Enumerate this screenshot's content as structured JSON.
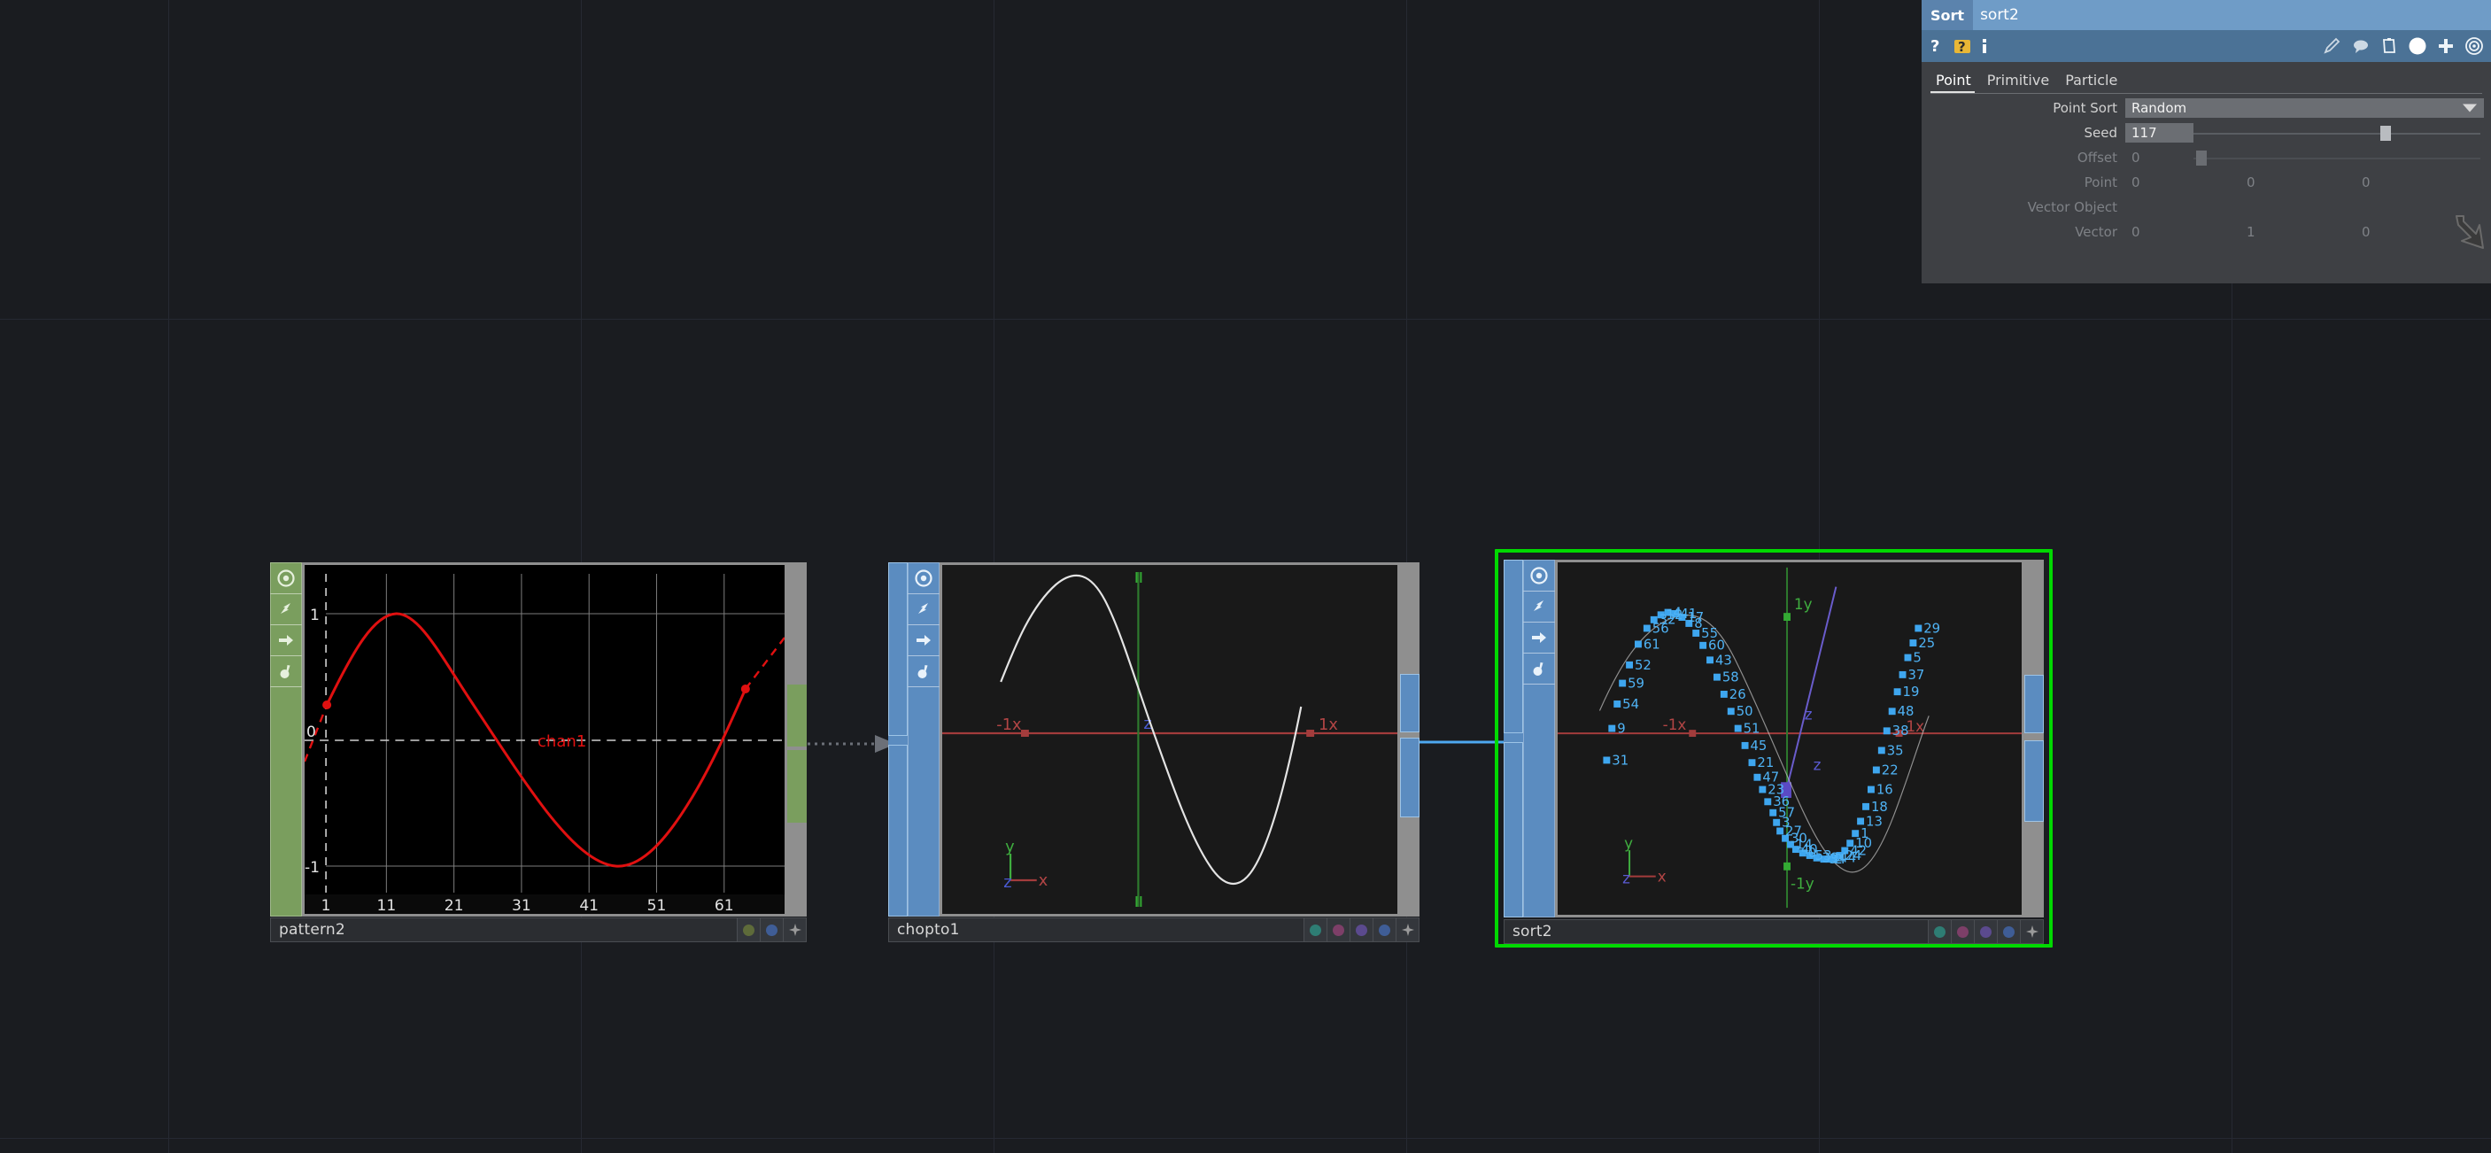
{
  "app": {
    "background": "#1a1c20",
    "grid_color": "#262932"
  },
  "parameter_panel": {
    "type_label": "Sort",
    "node_name": "sort2",
    "toolbar_left_icons": [
      "help-question-icon",
      "help-question-yellow-icon",
      "info-icon"
    ],
    "toolbar_right_icons": [
      "pencil-icon",
      "comment-icon",
      "clipboard-icon",
      "python-icon",
      "plus-icon",
      "target-icon"
    ],
    "tabs": [
      {
        "label": "Point",
        "active": true
      },
      {
        "label": "Primitive",
        "active": false
      },
      {
        "label": "Particle",
        "active": false
      }
    ],
    "rows": [
      {
        "label": "Point Sort",
        "type": "menu",
        "value": "Random",
        "enabled": true
      },
      {
        "label": "Seed",
        "type": "field_slider",
        "value": "117",
        "enabled": true,
        "slider_pct": 65
      },
      {
        "label": "Offset",
        "type": "field_slider",
        "value": "0",
        "enabled": false,
        "slider_pct": 2
      },
      {
        "label": "Point",
        "type": "vector3",
        "values": [
          "0",
          "0",
          "0"
        ],
        "enabled": false
      },
      {
        "label": "Vector Object",
        "type": "label_only",
        "value": "",
        "enabled": false
      },
      {
        "label": "Vector",
        "type": "vector3",
        "values": [
          "0",
          "1",
          "0"
        ],
        "enabled": false
      }
    ],
    "colors": {
      "title_bar": "#5b83ad",
      "tool_bar": "#4b7296",
      "body": "#3e4044",
      "field": "#6b6e73"
    }
  },
  "network": {
    "nodes": [
      {
        "name": "pattern2",
        "type": "channel-pattern",
        "selected": false,
        "accent": "#7a9e5e",
        "flags": [
          "display-render-icon",
          "channel-motion-icon",
          "bypass-arrow-icon",
          "lock-icon"
        ],
        "badges": [
          "olive-dot",
          "blue-dot",
          "plus-icon"
        ],
        "badge_colors": [
          "#5e6b3a",
          "#3f5d96",
          "#9a9a9a"
        ],
        "viewer_kind": "channel_graph"
      },
      {
        "name": "chopto1",
        "type": "chop-to-geometry",
        "selected": false,
        "accent": "#5b8cc0",
        "flags": [
          "display-render-icon",
          "channel-motion-icon",
          "bypass-arrow-icon",
          "lock-icon"
        ],
        "badges": [
          "teal-dot",
          "magenta-dot",
          "violet-dot",
          "blue-dot",
          "plus-icon"
        ],
        "badge_colors": [
          "#2e7d74",
          "#7d3f68",
          "#5b4a8e",
          "#3f5d96",
          "#9a9a9a"
        ],
        "viewer_kind": "geometry_curve"
      },
      {
        "name": "sort2",
        "type": "sort",
        "selected": true,
        "accent": "#5b8cc0",
        "flags": [
          "display-render-icon",
          "channel-motion-icon",
          "bypass-arrow-icon",
          "lock-icon"
        ],
        "badges": [
          "teal-dot",
          "magenta-dot",
          "violet-dot",
          "blue-dot",
          "plus-icon"
        ],
        "badge_colors": [
          "#2e7d74",
          "#7d3f68",
          "#5b4a8e",
          "#3f5d96",
          "#9a9a9a"
        ],
        "viewer_kind": "geometry_points"
      }
    ],
    "connections": [
      {
        "from": "pattern2",
        "to": "chopto1",
        "style": "dotted",
        "color": "#6c7078"
      },
      {
        "from": "chopto1",
        "to": "sort2",
        "style": "solid",
        "color": "#4ea8f0"
      }
    ],
    "selection_color": "#00d900"
  },
  "chart_data": [
    {
      "node": "pattern2",
      "type": "line",
      "title": "",
      "series_label": "chan1",
      "series_color": "#e01010",
      "xlabel": "",
      "ylabel": "",
      "xticks": [
        "1",
        "11",
        "21",
        "31",
        "41",
        "51",
        "61"
      ],
      "yticks": [
        "1",
        "0",
        "-1"
      ],
      "xlim": [
        -4,
        64
      ],
      "ylim": [
        -1.45,
        1.35
      ],
      "grid": true,
      "x": [
        1,
        6,
        11,
        13,
        16,
        21,
        26,
        31,
        36,
        41,
        43,
        46,
        51,
        56,
        61
      ],
      "values": [
        0.3,
        0.85,
        1.0,
        1.0,
        0.92,
        0.55,
        0.05,
        -0.5,
        -0.88,
        -1.0,
        -1.0,
        -0.86,
        -0.44,
        0.12,
        0.62
      ],
      "keyframes": [
        {
          "x": 1,
          "y": 0.3
        },
        {
          "x": 58,
          "y": 0.42
        }
      ],
      "extrapolation": "dashed-linear"
    },
    {
      "node": "chopto1",
      "type": "line",
      "title": "",
      "series_color": "#e8e8e8",
      "axis_labels": {
        "x_neg": "-1x",
        "x_pos": "1x",
        "z": "z"
      },
      "gnomon": [
        "y",
        "z",
        "x"
      ],
      "grid": false,
      "x": [
        0.0,
        0.05,
        0.1,
        0.15,
        0.2,
        0.25,
        0.3,
        0.35,
        0.4,
        0.45,
        0.5,
        0.55,
        0.6,
        0.65,
        0.7,
        0.75,
        0.8,
        0.85,
        0.9,
        0.95,
        1.0
      ],
      "values": [
        -0.35,
        0.18,
        0.62,
        0.92,
        1.05,
        1.02,
        0.86,
        0.56,
        0.18,
        -0.24,
        -0.62,
        -0.92,
        -1.1,
        -1.16,
        -1.08,
        -0.86,
        -0.5,
        -0.08,
        0.34,
        0.7,
        0.92
      ]
    },
    {
      "node": "sort2",
      "type": "scatter",
      "title": "",
      "point_color": "#3ea6ef",
      "axis_labels": {
        "x_neg": "-1x",
        "x_pos": "1x",
        "y_pos": "1y",
        "y_neg": "-1y",
        "z": "z"
      },
      "gnomon": [
        "y",
        "z",
        "x"
      ],
      "grid": false,
      "point_labels": [
        "31",
        "9",
        "54",
        "59",
        "52",
        "61",
        "56",
        "32",
        "12",
        "4",
        "41",
        "17",
        "8",
        "55",
        "60",
        "43",
        "58",
        "26",
        "50",
        "51",
        "45",
        "21",
        "47",
        "23",
        "36",
        "57",
        "3",
        "27",
        "30",
        "14",
        "40",
        "0",
        "53",
        "39",
        "34",
        "2",
        "44",
        "24",
        "42",
        "10",
        "1",
        "13",
        "18",
        "16",
        "22",
        "35",
        "38",
        "48",
        "19",
        "37",
        "5",
        "25",
        "29"
      ],
      "x": [
        0.04,
        0.055,
        0.07,
        0.085,
        0.105,
        0.13,
        0.155,
        0.175,
        0.195,
        0.215,
        0.235,
        0.255,
        0.275,
        0.295,
        0.315,
        0.335,
        0.355,
        0.375,
        0.395,
        0.415,
        0.435,
        0.455,
        0.47,
        0.485,
        0.5,
        0.515,
        0.525,
        0.535,
        0.55,
        0.565,
        0.58,
        0.6,
        0.62,
        0.64,
        0.66,
        0.675,
        0.69,
        0.705,
        0.72,
        0.735,
        0.75,
        0.765,
        0.78,
        0.795,
        0.81,
        0.825,
        0.84,
        0.855,
        0.87,
        0.885,
        0.9,
        0.915,
        0.93
      ],
      "values": [
        -0.22,
        0.04,
        0.24,
        0.41,
        0.56,
        0.73,
        0.86,
        0.93,
        0.97,
        0.99,
        0.98,
        0.95,
        0.9,
        0.82,
        0.72,
        0.6,
        0.46,
        0.32,
        0.18,
        0.04,
        -0.1,
        -0.24,
        -0.36,
        -0.46,
        -0.56,
        -0.65,
        -0.73,
        -0.8,
        -0.86,
        -0.91,
        -0.95,
        -0.98,
        -1.0,
        -1.02,
        -1.03,
        -1.03,
        -1.02,
        -1.0,
        -0.96,
        -0.9,
        -0.82,
        -0.72,
        -0.6,
        -0.46,
        -0.3,
        -0.14,
        0.02,
        0.18,
        0.34,
        0.48,
        0.62,
        0.74,
        0.86
      ]
    }
  ]
}
